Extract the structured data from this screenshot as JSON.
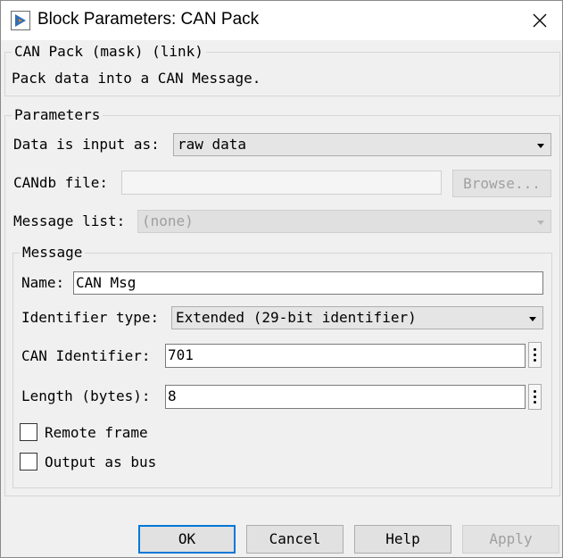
{
  "window": {
    "title": "Block Parameters: CAN Pack",
    "icon": "simulink-block-icon",
    "close_icon": "close-icon"
  },
  "description": {
    "legend": "CAN Pack (mask) (link)",
    "text": "Pack data into a CAN Message."
  },
  "parameters": {
    "legend": "Parameters",
    "data_input_label": "Data is input as:",
    "data_input_value": "raw data",
    "candb_label": "CANdb file:",
    "candb_value": "",
    "browse_label": "Browse...",
    "message_list_label": "Message list:",
    "message_list_value": "(none)"
  },
  "message": {
    "legend": "Message",
    "name_label": "Name:",
    "name_value": "CAN Msg",
    "identifier_type_label": "Identifier type:",
    "identifier_type_value": "Extended (29-bit identifier)",
    "can_identifier_label": "CAN Identifier:",
    "can_identifier_value": "701",
    "length_label": "Length (bytes):",
    "length_value": "8",
    "remote_frame_label": "Remote frame",
    "remote_frame_checked": false,
    "output_bus_label": "Output as bus",
    "output_bus_checked": false
  },
  "buttons": {
    "ok": "OK",
    "cancel": "Cancel",
    "help": "Help",
    "apply": "Apply"
  }
}
